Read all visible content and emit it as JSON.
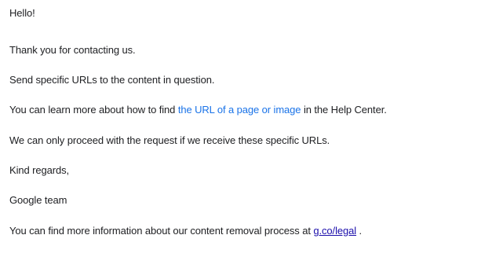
{
  "email": {
    "greeting": "Hello!",
    "thanks": "Thank you for contacting us.",
    "send_urls": "Send specific URLs to the content in question.",
    "learn_prefix": "You can learn more about how to find ",
    "learn_link": "the URL of a page or image",
    "learn_suffix": " in the Help Center.",
    "proceed": "We can only proceed with the request if we receive these specific URLs.",
    "regards": "Kind regards,",
    "signature": "Google team",
    "info_prefix": "You can find more information about our content removal process at ",
    "info_link": "g.co/legal",
    "info_suffix": " ."
  },
  "colors": {
    "text": "#202124",
    "link_blue": "#1a73e8",
    "link_underlined": "#1a0dab",
    "background": "#ffffff"
  }
}
